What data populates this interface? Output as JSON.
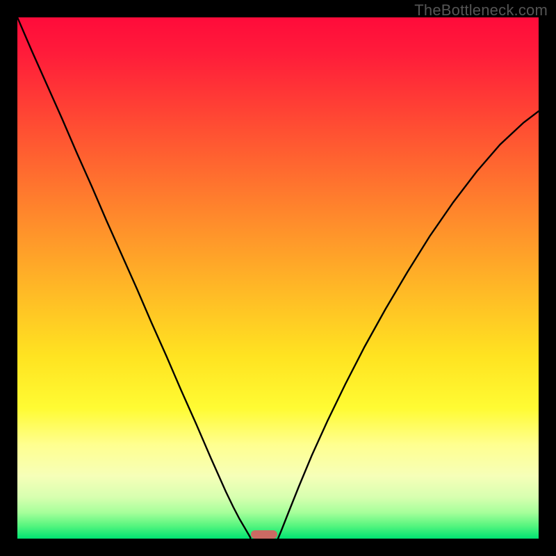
{
  "watermark": {
    "text": "TheBottleneck.com"
  },
  "chart_data": {
    "type": "line",
    "title": "",
    "xlabel": "",
    "ylabel": "",
    "xlim": [
      0,
      100
    ],
    "ylim": [
      0,
      100
    ],
    "grid": false,
    "legend": false,
    "background_gradient_stops": [
      {
        "offset": 0.0,
        "color": "#ff0b3a"
      },
      {
        "offset": 0.07,
        "color": "#ff1c3a"
      },
      {
        "offset": 0.2,
        "color": "#ff4a33"
      },
      {
        "offset": 0.35,
        "color": "#ff7e2d"
      },
      {
        "offset": 0.5,
        "color": "#ffb127"
      },
      {
        "offset": 0.65,
        "color": "#ffe321"
      },
      {
        "offset": 0.75,
        "color": "#fffb33"
      },
      {
        "offset": 0.82,
        "color": "#ffff90"
      },
      {
        "offset": 0.88,
        "color": "#f6ffb8"
      },
      {
        "offset": 0.92,
        "color": "#d8ffb0"
      },
      {
        "offset": 0.95,
        "color": "#a6ff9a"
      },
      {
        "offset": 0.975,
        "color": "#57f57f"
      },
      {
        "offset": 1.0,
        "color": "#00e472"
      }
    ],
    "series": [
      {
        "name": "left-curve",
        "color": "#000000",
        "x": [
          0.0,
          2.8,
          5.7,
          8.6,
          11.4,
          14.3,
          17.1,
          20.0,
          22.9,
          25.7,
          28.6,
          31.4,
          34.3,
          37.1,
          40.0,
          41.4,
          42.6,
          43.6,
          44.3,
          44.7,
          44.7
        ],
        "y": [
          100.0,
          93.5,
          87.0,
          80.5,
          74.0,
          67.5,
          61.0,
          54.5,
          48.0,
          41.5,
          35.0,
          28.5,
          22.0,
          15.5,
          9.0,
          6.1,
          3.8,
          2.1,
          0.9,
          0.2,
          0.0
        ]
      },
      {
        "name": "right-curve",
        "color": "#000000",
        "x": [
          50.0,
          50.7,
          52.0,
          54.0,
          56.5,
          59.5,
          62.9,
          66.6,
          70.6,
          74.8,
          79.1,
          83.6,
          88.1,
          92.6,
          97.1,
          100.0
        ],
        "y": [
          0.0,
          1.7,
          5.0,
          10.0,
          16.0,
          22.6,
          29.6,
          36.8,
          44.0,
          51.1,
          58.0,
          64.5,
          70.4,
          75.6,
          79.8,
          82.0
        ]
      }
    ],
    "marker": {
      "x_percent": 47.3,
      "y_percent": 99.2,
      "color": "#cb6a63"
    }
  }
}
